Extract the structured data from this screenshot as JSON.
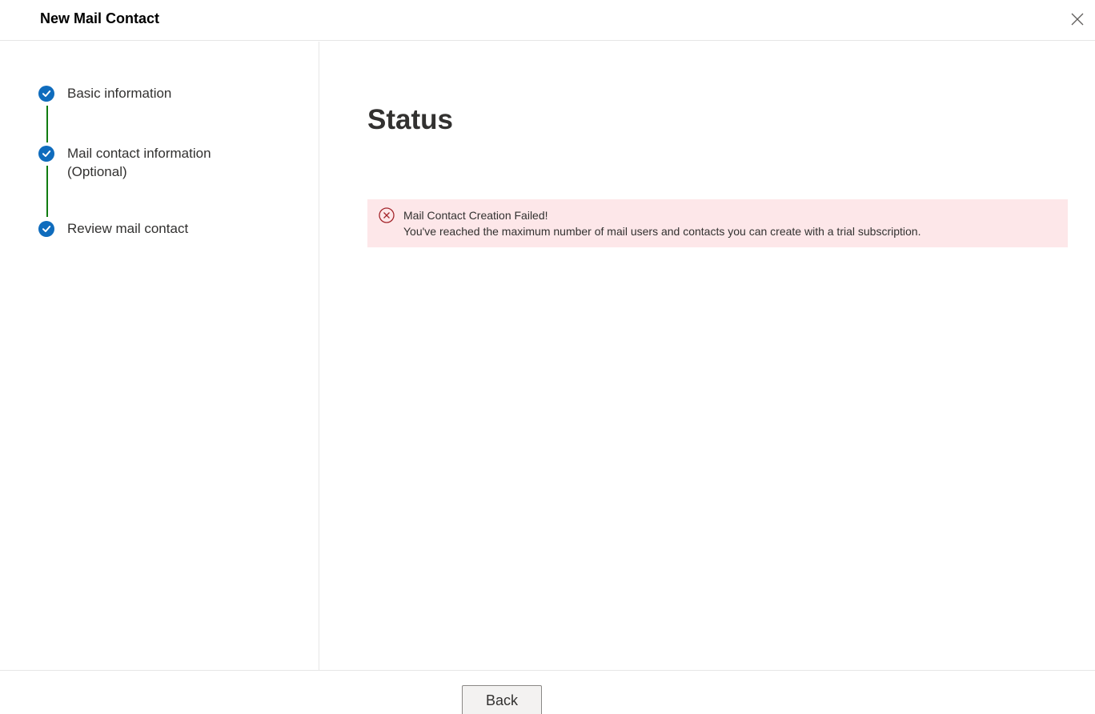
{
  "window": {
    "title": "New Mail Contact"
  },
  "steps": [
    {
      "label": "Basic information",
      "status": "completed"
    },
    {
      "label": "Mail contact information\n(Optional)",
      "status": "completed"
    },
    {
      "label": "Review mail contact",
      "status": "completed"
    }
  ],
  "main": {
    "heading": "Status",
    "error": {
      "title": "Mail Contact Creation Failed!",
      "message": "You've reached the maximum number of mail users and contacts you can create with a trial subscription."
    }
  },
  "footer": {
    "back_label": "Back"
  },
  "colors": {
    "step_circle": "#0f6cbd",
    "connector": "#107c10",
    "error_background": "#fde7e9",
    "error_icon": "#a4262c"
  }
}
